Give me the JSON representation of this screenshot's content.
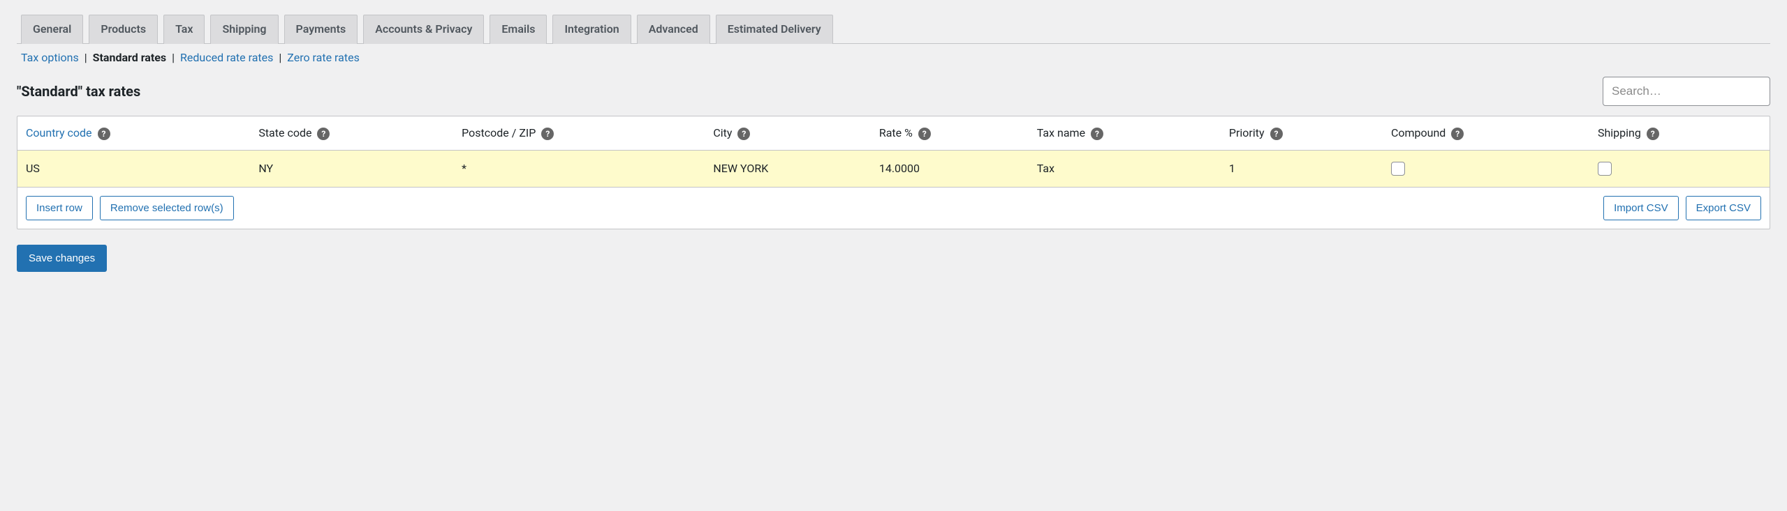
{
  "tabs": {
    "general": "General",
    "products": "Products",
    "tax": "Tax",
    "shipping": "Shipping",
    "payments": "Payments",
    "accounts": "Accounts & Privacy",
    "emails": "Emails",
    "integration": "Integration",
    "advanced": "Advanced",
    "estimated": "Estimated Delivery"
  },
  "subnav": {
    "tax_options": "Tax options",
    "standard": "Standard rates",
    "reduced": "Reduced rate rates",
    "zero": "Zero rate rates"
  },
  "section_title": "\"Standard\" tax rates",
  "search_placeholder": "Search…",
  "headers": {
    "country": "Country code",
    "state": "State code",
    "postcode": "Postcode / ZIP",
    "city": "City",
    "rate": "Rate %",
    "taxname": "Tax name",
    "priority": "Priority",
    "compound": "Compound",
    "shipping": "Shipping"
  },
  "row": {
    "country": "US",
    "state": "NY",
    "postcode": "*",
    "city": "NEW YORK",
    "rate": "14.0000",
    "taxname": "Tax",
    "priority": "1"
  },
  "buttons": {
    "insert": "Insert row",
    "remove": "Remove selected row(s)",
    "import": "Import CSV",
    "export": "Export CSV",
    "save": "Save changes"
  }
}
